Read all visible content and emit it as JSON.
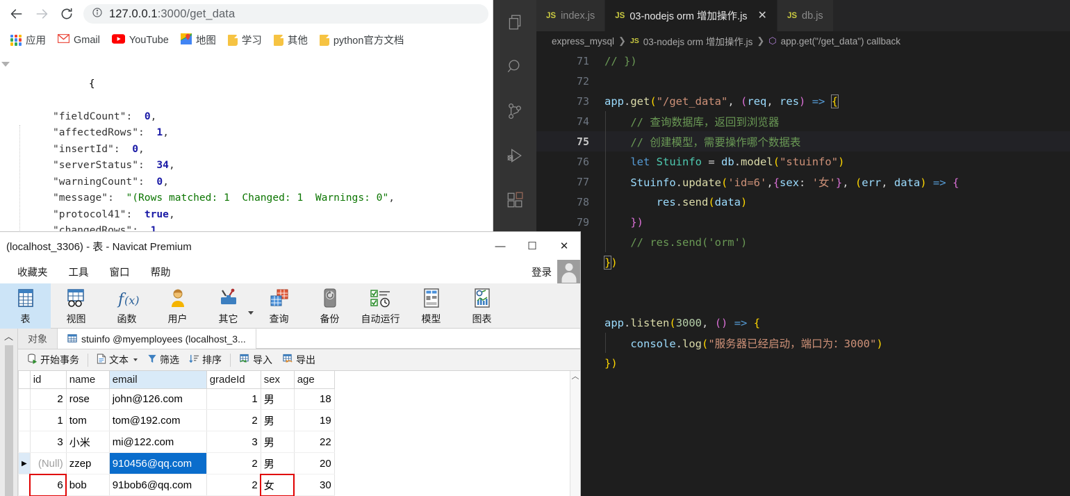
{
  "browser": {
    "nav": {
      "back": "←",
      "forward": "→",
      "reload": "⟳"
    },
    "url_host": "127.0.0.1",
    "url_rest": ":3000/get_data",
    "info_icon": "ⓘ",
    "bookmarks": [
      {
        "label": "应用",
        "icon": "apps-grid-icon"
      },
      {
        "label": "Gmail",
        "icon": "gmail-icon"
      },
      {
        "label": "YouTube",
        "icon": "youtube-icon"
      },
      {
        "label": "地图",
        "icon": "maps-icon"
      },
      {
        "label": "学习",
        "icon": "folder-icon"
      },
      {
        "label": "其他",
        "icon": "folder-icon"
      },
      {
        "label": "python官方文档",
        "icon": "folder-icon"
      }
    ],
    "json_response": {
      "open_brace": "{",
      "close_brace": "}",
      "rows": [
        {
          "key": "\"fieldCount\"",
          "sep": ":",
          "value": "0",
          "type": "num",
          "comma": ","
        },
        {
          "key": "\"affectedRows\"",
          "sep": ":",
          "value": "1",
          "type": "num",
          "comma": ","
        },
        {
          "key": "\"insertId\"",
          "sep": ":",
          "value": "0",
          "type": "num",
          "comma": ","
        },
        {
          "key": "\"serverStatus\"",
          "sep": ":",
          "value": "34",
          "type": "num",
          "comma": ","
        },
        {
          "key": "\"warningCount\"",
          "sep": ":",
          "value": "0",
          "type": "num",
          "comma": ","
        },
        {
          "key": "\"message\"",
          "sep": ":",
          "value": "\"(Rows matched: 1  Changed: 1  Warnings: 0\"",
          "type": "str",
          "comma": ","
        },
        {
          "key": "\"protocol41\"",
          "sep": ":",
          "value": "true",
          "type": "bool",
          "comma": ","
        },
        {
          "key": "\"changedRows\"",
          "sep": ":",
          "value": "1",
          "type": "num",
          "comma": ""
        }
      ]
    }
  },
  "vscode": {
    "activity_items": [
      "explorer-icon",
      "search-icon",
      "source-control-icon",
      "run-debug-icon",
      "extensions-icon"
    ],
    "tabs": [
      {
        "label": "index.js",
        "badge": "JS",
        "active": false,
        "closable": false
      },
      {
        "label": "03-nodejs orm 增加操作.js",
        "badge": "JS",
        "active": true,
        "closable": true,
        "close": "✕"
      },
      {
        "label": "db.js",
        "badge": "JS",
        "active": false,
        "closable": false
      }
    ],
    "breadcrumb": {
      "folder": "express_mysql",
      "file_badge": "JS",
      "file": "03-nodejs orm 增加操作.js",
      "symbol_badge": "⬡",
      "symbol": "app.get(\"/get_data\") callback",
      "separator": "❯"
    },
    "active_line": 75,
    "code_lines": [
      {
        "num": "71",
        "text": "// })"
      },
      {
        "num": "72",
        "text": ""
      },
      {
        "num": "73",
        "text": "app.get(\"/get_data\", (req, res) => {"
      },
      {
        "num": "74",
        "text": "    // 查询数据库，返回到浏览器"
      },
      {
        "num": "75",
        "text": "    // 创建模型，需要操作哪个数据表"
      },
      {
        "num": "76",
        "text": "    let Stuinfo = db.model(\"stuinfo\")"
      },
      {
        "num": "77",
        "text": "    Stuinfo.update('id=6',{sex: '女'}, (err, data) => {"
      },
      {
        "num": "78",
        "text": "        res.send(data)"
      },
      {
        "num": "79",
        "text": "    })"
      },
      {
        "num": "",
        "text": "    // res.send('orm')"
      },
      {
        "num": "",
        "text": "})"
      },
      {
        "num": "",
        "text": ""
      },
      {
        "num": "",
        "text": ""
      },
      {
        "num": "",
        "text": "app.listen(3000, () => {"
      },
      {
        "num": "",
        "text": "    console.log(\"服务器已经启动，端口为：3000\")"
      },
      {
        "num": "",
        "text": "})"
      }
    ]
  },
  "navicat": {
    "title": "(localhost_3306) - 表 - Navicat Premium",
    "window_buttons": {
      "minimize": "―",
      "maximize": "☐",
      "close": "✕"
    },
    "menu": [
      "收藏夹",
      "工具",
      "窗口",
      "帮助"
    ],
    "login_label": "登录",
    "toolbar": [
      {
        "label": "表",
        "icon": "table-icon",
        "selected": true,
        "caret": false
      },
      {
        "label": "视图",
        "icon": "view-icon",
        "selected": false,
        "caret": false
      },
      {
        "label": "函数",
        "icon": "function-icon",
        "selected": false,
        "caret": false
      },
      {
        "label": "用户",
        "icon": "user-icon",
        "selected": false,
        "caret": false
      },
      {
        "label": "其它",
        "icon": "other-icon",
        "selected": false,
        "caret": true
      },
      {
        "label": "查询",
        "icon": "query-icon",
        "selected": false,
        "caret": false
      },
      {
        "label": "备份",
        "icon": "backup-icon",
        "selected": false,
        "caret": false
      },
      {
        "label": "自动运行",
        "icon": "automation-icon",
        "selected": false,
        "caret": false
      },
      {
        "label": "模型",
        "icon": "model-icon",
        "selected": false,
        "caret": false
      },
      {
        "label": "图表",
        "icon": "chart-icon",
        "selected": false,
        "caret": false
      }
    ],
    "collapse_chevron": "︿",
    "tabs": [
      {
        "label": "对象",
        "active": false,
        "icon": ""
      },
      {
        "label": "stuinfo @myemployees (localhost_3...",
        "active": true,
        "icon": "table-icon"
      }
    ],
    "subbar": [
      {
        "label": "开始事务",
        "icon": "transaction-icon",
        "caret": false
      },
      {
        "label": "文本",
        "icon": "text-icon",
        "caret": true
      },
      {
        "label": "筛选",
        "icon": "filter-icon",
        "caret": false
      },
      {
        "label": "排序",
        "icon": "sort-icon",
        "caret": false
      },
      {
        "label": "导入",
        "icon": "import-icon",
        "caret": false
      },
      {
        "label": "导出",
        "icon": "export-icon",
        "caret": false
      }
    ],
    "grid": {
      "columns": [
        "id",
        "name",
        "email",
        "gradeId",
        "sex",
        "age"
      ],
      "selected_column": "email",
      "rows": [
        {
          "marker": "",
          "current": false,
          "id": "2",
          "id_null": false,
          "name": "rose",
          "email": "john@126.com",
          "email_selected": false,
          "gradeId": "1",
          "sex": "男",
          "age": "18",
          "annot_id": false,
          "annot_sex": false
        },
        {
          "marker": "",
          "current": false,
          "id": "1",
          "id_null": false,
          "name": "tom",
          "email": "tom@192.com",
          "email_selected": false,
          "gradeId": "2",
          "sex": "男",
          "age": "19",
          "annot_id": false,
          "annot_sex": false
        },
        {
          "marker": "",
          "current": false,
          "id": "3",
          "id_null": false,
          "name": "小米",
          "email": "mi@122.com",
          "email_selected": false,
          "gradeId": "3",
          "sex": "男",
          "age": "22",
          "annot_id": false,
          "annot_sex": false
        },
        {
          "marker": "▶",
          "current": true,
          "id": "(Null)",
          "id_null": true,
          "name": "zzep",
          "email": "910456@qq.com",
          "email_selected": true,
          "gradeId": "2",
          "sex": "男",
          "age": "20",
          "annot_id": false,
          "annot_sex": false
        },
        {
          "marker": "",
          "current": false,
          "id": "6",
          "id_null": false,
          "name": "bob",
          "email": "91bob6@qq.com",
          "email_selected": false,
          "gradeId": "2",
          "sex": "女",
          "age": "30",
          "annot_id": true,
          "annot_sex": true
        }
      ],
      "scroll_up": "︿"
    }
  },
  "colors": {
    "vscode_bg": "#1e1e1e",
    "vscode_tabbar": "#252526",
    "accent_blue": "#0a6dcc",
    "annotation_red": "#e00000",
    "navicat_selected": "#cce4f7"
  }
}
